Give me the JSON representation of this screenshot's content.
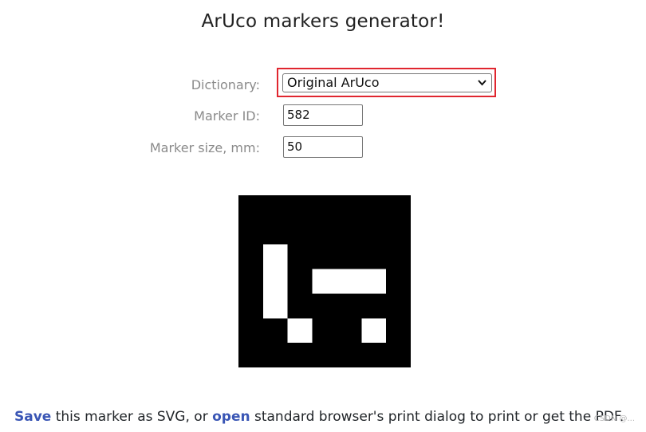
{
  "page": {
    "title": "ArUco markers generator!"
  },
  "form": {
    "dictionary": {
      "label": "Dictionary:",
      "selected": "Original ArUco"
    },
    "marker_id": {
      "label": "Marker ID:",
      "value": "582"
    },
    "marker_size": {
      "label": "Marker size, mm:",
      "value": "50"
    }
  },
  "marker": {
    "grid_cells": 7,
    "bits": [
      [
        0,
        0,
        0,
        0,
        0
      ],
      [
        1,
        0,
        0,
        0,
        0
      ],
      [
        1,
        0,
        1,
        1,
        1
      ],
      [
        1,
        0,
        0,
        0,
        0
      ],
      [
        0,
        1,
        0,
        0,
        1
      ]
    ],
    "foreground": "#000000",
    "background": "#ffffff"
  },
  "footer": {
    "save_link": "Save",
    "text_1": " this marker as SVG, or ",
    "open_link": "open",
    "text_2": " standard browser's print dialog to print or get the PDF."
  },
  "watermark": "CSDN @..."
}
